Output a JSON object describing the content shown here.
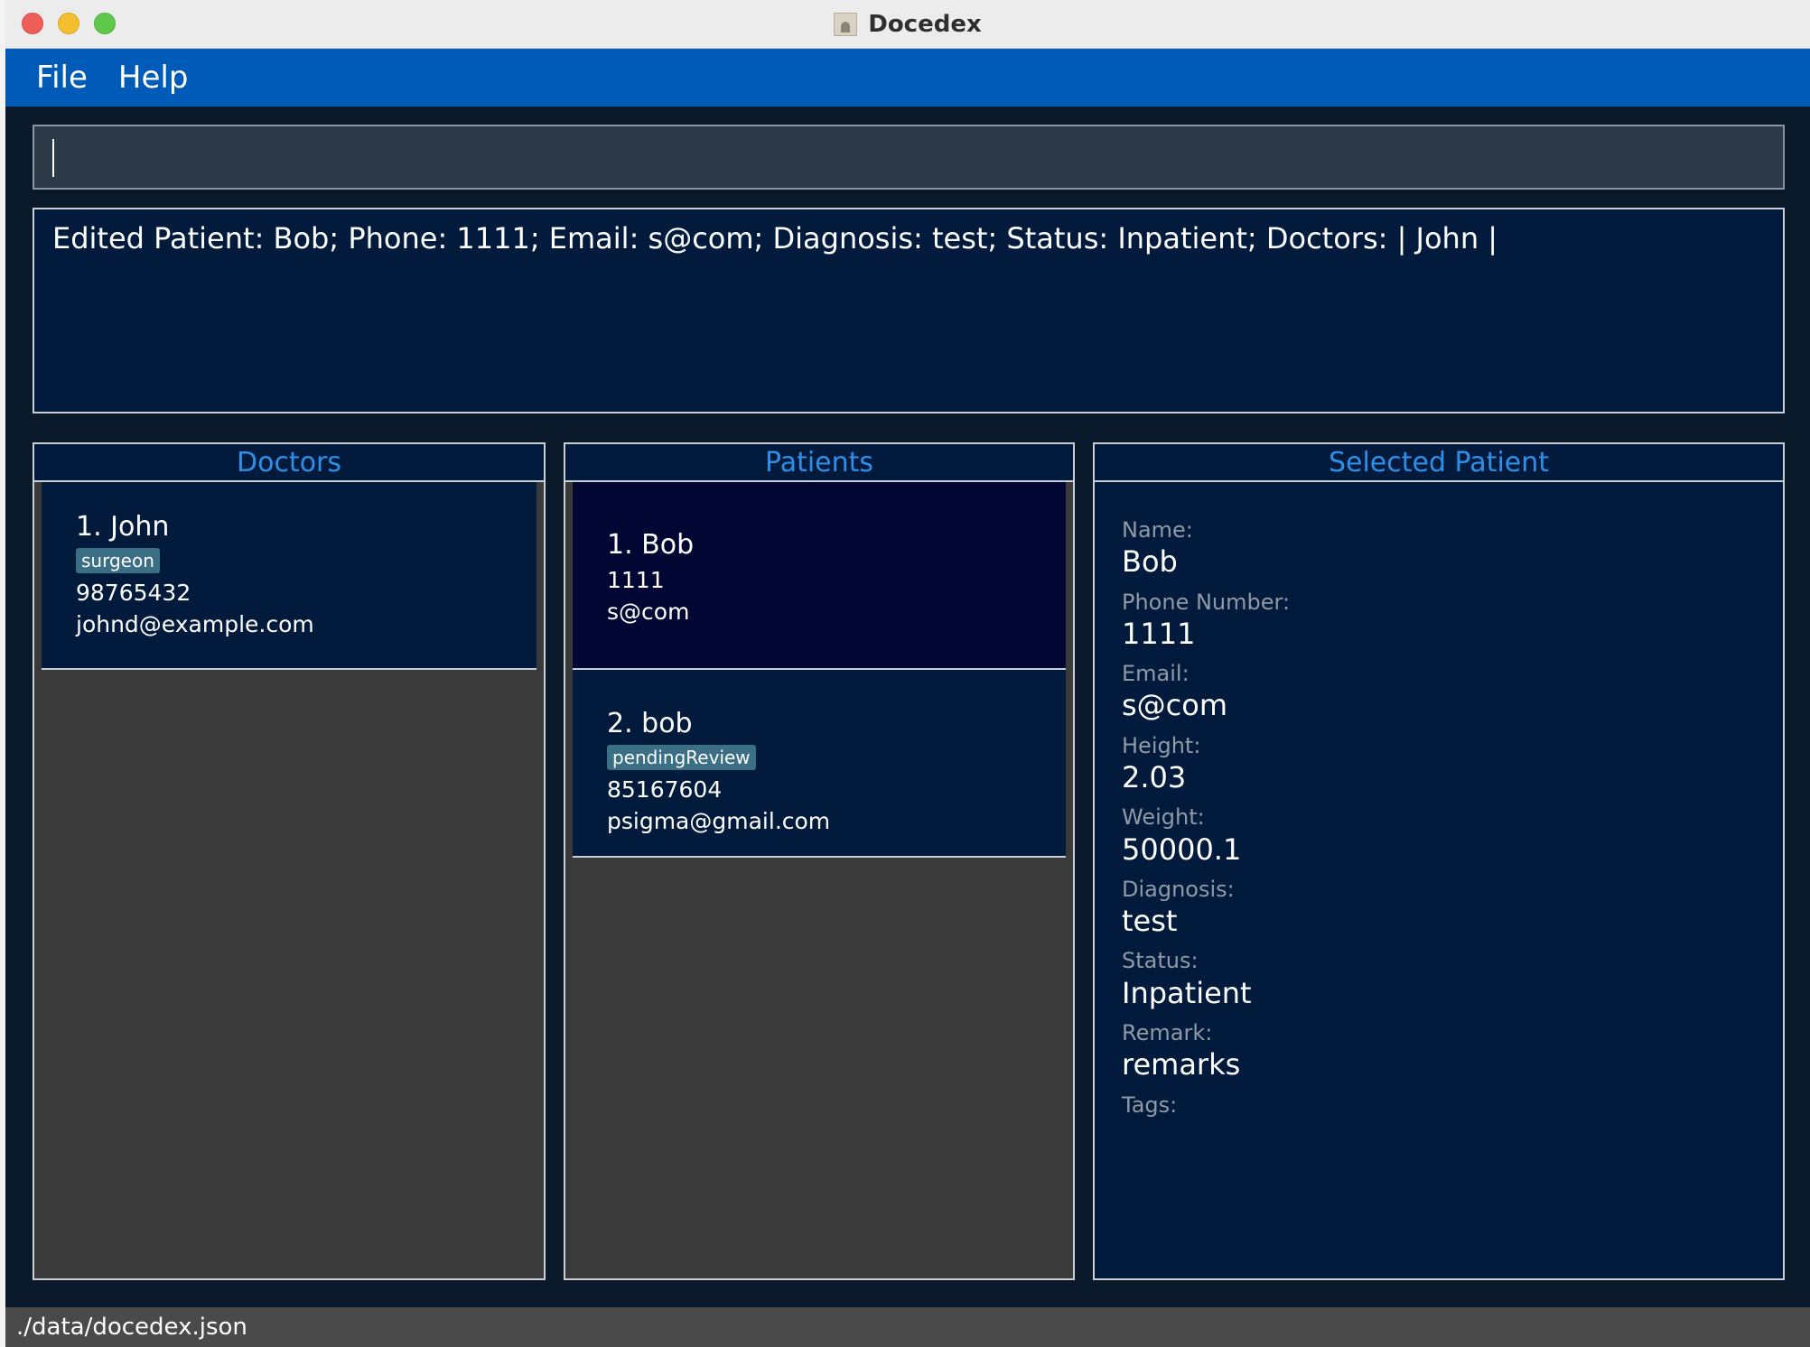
{
  "window": {
    "title": "Docedex"
  },
  "menu": {
    "file": "File",
    "help": "Help"
  },
  "command": {
    "value": ""
  },
  "result": {
    "text": "Edited Patient: Bob; Phone: 1111; Email: s@com; Diagnosis: test; Status: Inpatient; Doctors: | John |"
  },
  "doctors": {
    "title": "Doctors",
    "items": [
      {
        "name": "1.  John",
        "tag": "surgeon",
        "phone": "98765432",
        "email": "johnd@example.com"
      }
    ]
  },
  "patients": {
    "title": "Patients",
    "items": [
      {
        "name": "1.  Bob",
        "phone": "1111",
        "email": "s@com"
      },
      {
        "name": "2.  bob",
        "tag": "pendingReview",
        "phone": "85167604",
        "email": "psigma@gmail.com"
      }
    ]
  },
  "selected": {
    "title": "Selected Patient",
    "fields": [
      {
        "label": "Name:",
        "value": "Bob"
      },
      {
        "label": "Phone Number:",
        "value": "1111"
      },
      {
        "label": "Email:",
        "value": "s@com"
      },
      {
        "label": "Height:",
        "value": "2.03"
      },
      {
        "label": "Weight:",
        "value": "50000.1"
      },
      {
        "label": "Diagnosis:",
        "value": "test"
      },
      {
        "label": "Status:",
        "value": "Inpatient"
      },
      {
        "label": "Remark:",
        "value": "remarks"
      },
      {
        "label": "Tags:",
        "value": ""
      }
    ]
  },
  "status": {
    "path": "./data/docedex.json"
  }
}
